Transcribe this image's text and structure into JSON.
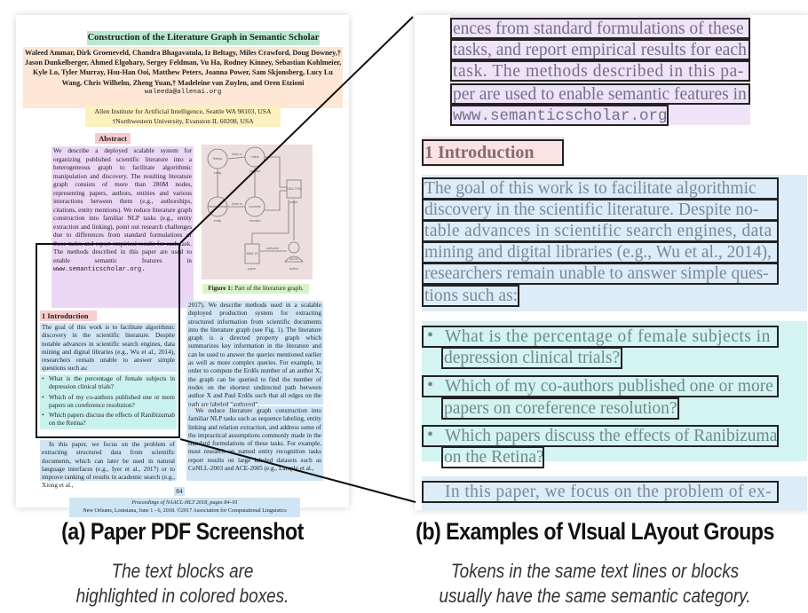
{
  "paper": {
    "title": "Construction of the Literature Graph in Semantic Scholar",
    "authors": "Waleed Ammar, Dirk Groeneveld, Chandra Bhagavatula, Iz Beltagy, Miles Crawford, Doug Downey,† Jason Dunkelberger, Ahmed Elgohary, Sergey Feldman, Vu Ha, Rodney Kinney, Sebastian Kohlmeier, Kyle Lo, Tyler Murray, Hsu-Han Ooi, Matthew Peters, Joanna Power, Sam Skjonsberg, Lucy Lu Wang, Chris Wilhelm, Zheng Yuan,† Madeleine van Zuylen, and Oren Etzioni",
    "email": "waleeda@allenai.org",
    "affiliation_1": "Allen Institute for Artificial Intelligence, Seattle WA 98103, USA",
    "affiliation_2": "†Northwestern University, Evanston IL 60208, USA",
    "abstract_heading": "Abstract",
    "abstract_text": "We describe a deployed scalable system for organizing published scientific literature into a heterogeneous graph to facilitate algorithmic manipulation and discovery. The resulting literature graph consists of more than 280M nodes, representing papers, authors, entities and various interactions between them (e.g., authorships, citations, entity mentions). We reduce literature graph construction into familiar NLP tasks (e.g., entity extraction and linking), point out research challenges due to differences from standard formulations of these tasks, and report empirical results for each task. The methods described in this paper are used to enable semantic features in",
    "abstract_url": "www.semanticscholar.org.",
    "figure": {
      "nodes": {
        "retina": "Retina",
        "entity_1": "entity",
        "retina_mention": "retina",
        "mention_1": "mention",
        "ranibizumab": "Ranibi-zumab",
        "entity_2": "entity",
        "lucentis": "Lucentis",
        "mention_2": "mention",
        "paper_1_id": "2364 2784",
        "paper_1": "paper",
        "paper_2_id": "8884 13",
        "paper_2": "paper",
        "author_id": "84134",
        "author": "author"
      },
      "edges": {
        "links_to_1": "links to",
        "links_to_2": "links to",
        "affects": "affects",
        "mentioned_in_1": "mentioned in",
        "mentioned_in_2": "mentioned in",
        "cites": "cites",
        "authored_1": "authored",
        "authored_2": "authored",
        "annotates": "annotates"
      }
    },
    "caption_label": "Figure 1:",
    "caption_text": " Part of the literature graph.",
    "section_heading": "1   Introduction",
    "intro_para_1": "The goal of this work is to facilitate algorithmic discovery in the scientific literature. Despite notable advances in scientific search engines, data mining and digital libraries (e.g., Wu et al., 2014), researchers remain unable to answer simple questions such as:",
    "intro_questions": [
      "What is the percentage of female subjects in depression clinical trials?",
      "Which of my co-authors published one or more papers on coreference resolution?",
      "Which papers discuss the effects of Ranibizumab on the Retina?"
    ],
    "intro_para_2": "In this paper, we focus on the problem of extracting structured data from scientific documents, which can later be used in natural language interfaces (e.g., Iyer et al., 2017) or to improve ranking of results in academic search (e.g., Xiong et al.,",
    "col2_para_1": "2017). We describe methods used in a scalable deployed production system for extracting structured information from scientific documents into the literature graph (see Fig. 1). The literature graph is a directed property graph which summarizes key information in the literature and can be used to answer the queries mentioned earlier as well as more complex queries. For example, in order to compute the Erdős number of an author X, the graph can be queried to find the number of nodes on the shortest undirected path between author X and Paul Erdős such that all edges on the path are labeled \"authored\".",
    "col2_para_2": "We reduce literature graph construction into familiar NLP tasks such as sequence labeling, entity linking and relation extraction, and address some of the impractical assumptions commonly made in the standard formulations of these tasks. For example, most research on named entity recognition tasks report results on large labeled datasets such as CoNLL-2003 and ACE-2005 (e.g., Lample et al.,",
    "page_number": "84",
    "footer_line_1": "Proceedings of NAACL-HLT 2018, pages 84–91",
    "footer_line_2": "New Orleans, Louisiana, June 1 - 6, 2018. ©2017 Association for Computational Linguistics"
  },
  "zoomed": {
    "abstract_lines": [
      "ences from standard formulations of these",
      "tasks, and report empirical results for each",
      "task.  The methods described in this pa-",
      "per are used to enable semantic features in",
      "www.semanticscholar.org."
    ],
    "section_heading": "1   Introduction",
    "body_lines": [
      "The goal of this work is to facilitate algorithmic",
      "discovery in the scientific literature.  Despite no-",
      "table advances in scientific search engines, data",
      "mining and digital libraries (e.g., Wu et al., 2014),",
      "researchers remain unable to answer simple ques-",
      "tions such as:"
    ],
    "list_lines": [
      "What is the percentage of female subjects in",
      "depression clinical trials?",
      "Which of my co-authors published one or more",
      "papers on coreference resolution?",
      "Which papers discuss the effects of Ranibizumab",
      "on the Retina?"
    ],
    "tail_line": "In this paper, we focus on the problem of ex-",
    "bullet_glyph": "•"
  },
  "captions": {
    "a_title": "(a) Paper PDF Screenshot",
    "a_sub_1": "The text blocks are",
    "a_sub_2": "highlighted in colored boxes.",
    "b_title": "(b) Examples of VIsual LAyout Groups",
    "b_sub_1": "Tokens in the same text lines or blocks",
    "b_sub_2": "usually have the same semantic category."
  },
  "colors": {
    "title_block": "#b9e8cf",
    "author_block": "#fde6d4",
    "affiliation_block": "#fdf0bf",
    "abstract_block": "#ebd7f5",
    "section_block": "#f7cdcd",
    "body_block": "#cfe5f5",
    "list_block": "#c9f1ee",
    "caption_block": "#d9f3c7",
    "figure_block": "#ecdede"
  }
}
